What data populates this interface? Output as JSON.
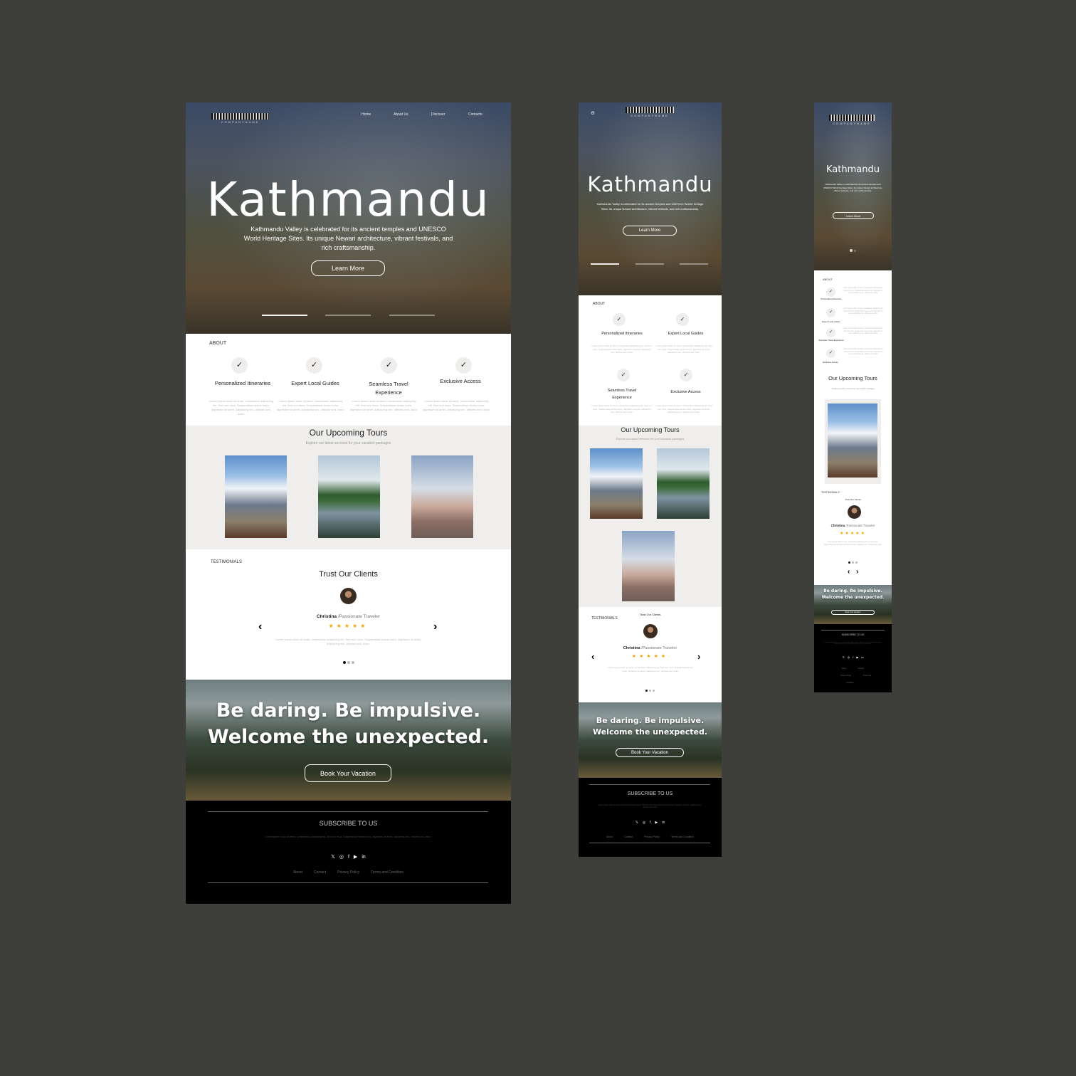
{
  "brand": {
    "logo_text": "COMPANYNAME"
  },
  "nav": [
    "Home",
    "About Us",
    "Discover",
    "Contacts"
  ],
  "hero": {
    "title": "Kathmandu",
    "text": "Kathmandu Valley is celebrated for its ancient temples and UNESCO World Heritage Sites. Its unique Newari architecture, vibrant festivals, and rich craftsmanship.",
    "button": "Learn More"
  },
  "about": {
    "label": "ABOUT",
    "features": [
      "Personalized Itineraries",
      "Expert Local Guides",
      "Seamless Travel Experience",
      "Exclusive Access"
    ],
    "lorem": "Lorem ipsum dolor sit amet, consectetur adipiscing elit. Sed non risus. Suspendisse lectus tortor, dignissim sit amet, adipiscing nec, ultricies sed, dolor."
  },
  "tours": {
    "title": "Our Upcoming Tours",
    "subtitle": "Explore our latest services for your vacation packages"
  },
  "testimonials": {
    "label": "TESTIMONIALS",
    "title": "Trust Our Clients",
    "name": "Christina",
    "role": " /Passionate Traveler",
    "stars": "★★★★★",
    "text": "Lorem ipsum dolor sit amet, consectetur adipiscing elit. Sed non risus. Suspendisse lectus tortor, dignissim sit amet, adipiscing nec, ultricies sed, dolor.",
    "prev": "‹",
    "next": "›"
  },
  "cta": {
    "line1": "Be daring. Be impulsive.",
    "line2": "Welcome the unexpected.",
    "button": "Book Your Vacation"
  },
  "footer": {
    "title": "SUBSCRIBE TO US",
    "text": "Lorem ipsum dolor sit amet, consectetur adipiscing elit. Sed non risus. Suspendisse lectus tortor, dignissim sit amet, adipiscing nec, ultricies sed, dolor.",
    "social": [
      "𝕏",
      "◎",
      "f",
      "▶",
      "in"
    ],
    "links": [
      "About",
      "Contact",
      "Privacy Policy",
      "Terms and Condition"
    ]
  },
  "colors": {
    "background": "#3e3f3a",
    "star": "#f0a500",
    "footer": "#000000"
  }
}
